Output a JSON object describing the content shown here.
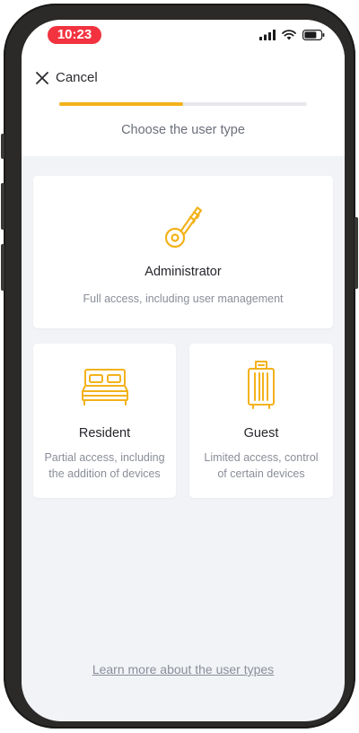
{
  "status": {
    "time": "10:23",
    "icons": [
      "cellular-signal-icon",
      "wifi-icon",
      "battery-icon"
    ]
  },
  "header": {
    "cancel_label": "Cancel",
    "progress_fraction": 0.5,
    "subtitle": "Choose the user type"
  },
  "options": [
    {
      "icon": "key-icon",
      "title": "Administrator",
      "description": "Full access, including user management"
    },
    {
      "icon": "bed-icon",
      "title": "Resident",
      "description": "Partial access, including the addition of devices"
    },
    {
      "icon": "suitcase-icon",
      "title": "Guest",
      "description": "Limited access, control of certain devices"
    }
  ],
  "footer": {
    "link_label": "Learn more about the user types"
  },
  "colors": {
    "accent": "#f3b21b",
    "status_time_bg": "#f2333f",
    "background": "#f1f3f7"
  }
}
